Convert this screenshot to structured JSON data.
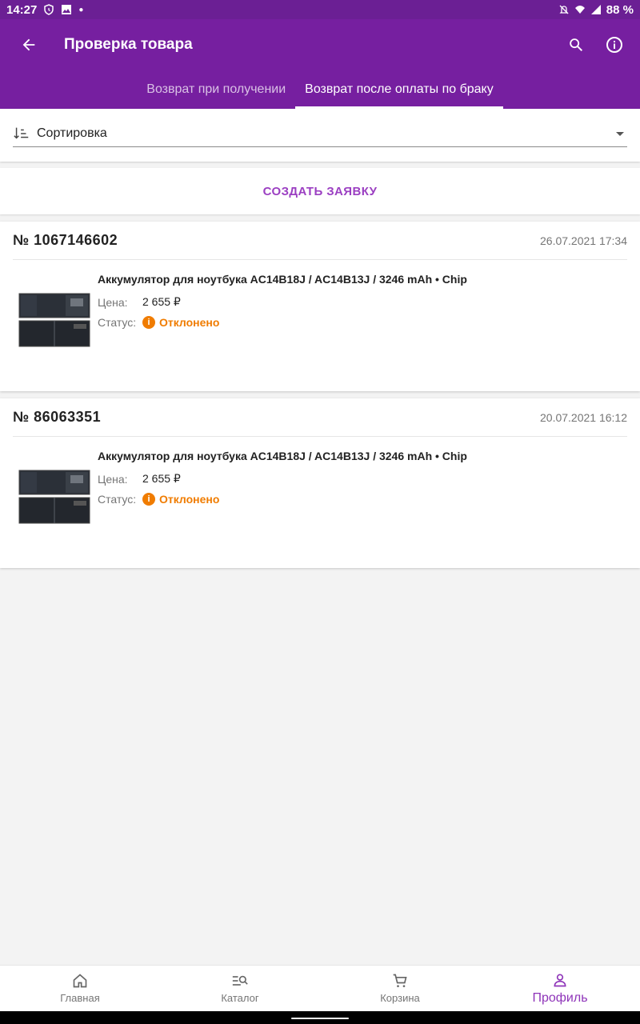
{
  "status_bar": {
    "time": "14:27",
    "battery": "88 %"
  },
  "app_bar": {
    "title": "Проверка товара",
    "tabs": [
      {
        "label": "Возврат при получении",
        "active": false
      },
      {
        "label": "Возврат после оплаты по браку",
        "active": true
      }
    ]
  },
  "sort": {
    "label": "Сортировка"
  },
  "create_button": {
    "label": "СОЗДАТЬ ЗАЯВКУ"
  },
  "orders": [
    {
      "number": "№ 1067146602",
      "date": "26.07.2021 17:34",
      "product_name": "Аккумулятор для ноутбука AC14B18J / AC14B13J / 3246 mAh • Chip",
      "price_label": "Цена:",
      "price": "2 655 ₽",
      "status_label": "Статус:",
      "status": "Отклонено"
    },
    {
      "number": "№ 86063351",
      "date": "20.07.2021 16:12",
      "product_name": "Аккумулятор для ноутбука AC14B18J / AC14B13J / 3246 mAh • Chip",
      "price_label": "Цена:",
      "price": "2 655 ₽",
      "status_label": "Статус:",
      "status": "Отклонено"
    }
  ],
  "bottom_nav": [
    {
      "label": "Главная",
      "icon": "home-icon",
      "active": false
    },
    {
      "label": "Каталог",
      "icon": "catalog-icon",
      "active": false
    },
    {
      "label": "Корзина",
      "icon": "cart-icon",
      "active": false
    },
    {
      "label": "Профиль",
      "icon": "profile-icon",
      "active": true
    }
  ],
  "colors": {
    "app_bar": "#761fa0",
    "status_bar": "#6b1f94",
    "accent": "#9b3fc2",
    "status_rejected": "#f07c00"
  }
}
